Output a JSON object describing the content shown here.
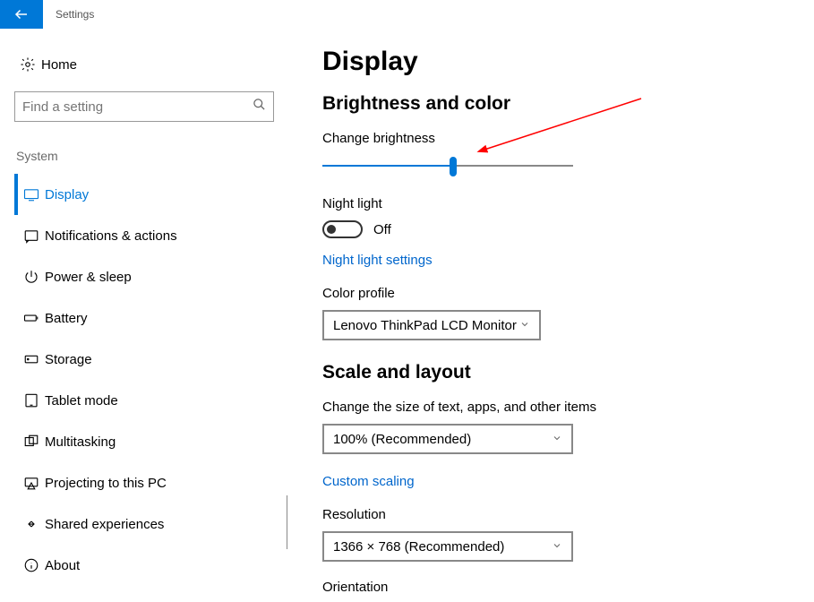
{
  "titlebar": {
    "app_name": "Settings"
  },
  "sidebar": {
    "home_label": "Home",
    "search_placeholder": "Find a setting",
    "section_caption": "System",
    "items": [
      {
        "label": "Display",
        "selected": true
      },
      {
        "label": "Notifications & actions",
        "selected": false
      },
      {
        "label": "Power & sleep",
        "selected": false
      },
      {
        "label": "Battery",
        "selected": false
      },
      {
        "label": "Storage",
        "selected": false
      },
      {
        "label": "Tablet mode",
        "selected": false
      },
      {
        "label": "Multitasking",
        "selected": false
      },
      {
        "label": "Projecting to this PC",
        "selected": false
      },
      {
        "label": "Shared experiences",
        "selected": false
      },
      {
        "label": "About",
        "selected": false
      }
    ]
  },
  "main": {
    "page_title": "Display",
    "brightness_section": {
      "title": "Brightness and color",
      "change_brightness_label": "Change brightness",
      "brightness_percent": 52,
      "night_light_label": "Night light",
      "night_light_state": "Off",
      "night_light_settings_link": "Night light settings",
      "color_profile_label": "Color profile",
      "color_profile_value": "Lenovo ThinkPad LCD Monitor"
    },
    "scale_section": {
      "title": "Scale and layout",
      "scale_label": "Change the size of text, apps, and other items",
      "scale_value": "100% (Recommended)",
      "custom_scaling_link": "Custom scaling",
      "resolution_label": "Resolution",
      "resolution_value": "1366 × 768 (Recommended)",
      "orientation_label": "Orientation"
    }
  }
}
